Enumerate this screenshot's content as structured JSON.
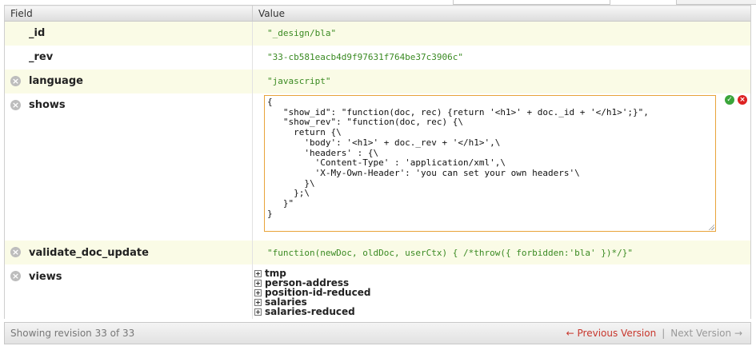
{
  "headers": {
    "field": "Field",
    "value": "Value"
  },
  "rows": {
    "id": {
      "key": "_id",
      "value": "\"_design/bla\""
    },
    "rev": {
      "key": "_rev",
      "value": "\"33-cb581eacb4d9f97631f764be37c3906c\""
    },
    "language": {
      "key": "language",
      "value": "\"javascript\""
    },
    "shows": {
      "key": "shows",
      "editor_text": "{\n   \"show_id\": \"function(doc, rec) {return '<h1>' + doc._id + '</h1>';}\",\n   \"show_rev\": \"function(doc, rec) {\\\n     return {\\\n       'body': '<h1>' + doc._rev + '</h1>',\\\n       'headers' : {\\\n         'Content-Type' : 'application/xml',\\\n         'X-My-Own-Header': 'you can set your own headers'\\\n       }\\\n     };\\\n   }\"\n}"
    },
    "validate": {
      "key": "validate_doc_update",
      "value": "\"function(newDoc, oldDoc, userCtx) { /*throw({ forbidden:'bla' })*/}\""
    },
    "views": {
      "key": "views",
      "items": [
        "tmp",
        "person-address",
        "position-id-reduced",
        "salaries",
        "salaries-reduced"
      ]
    }
  },
  "icons": {
    "delete": "×",
    "save": "✓",
    "cancel": "×",
    "expand": "+"
  },
  "footer": {
    "status": "Showing revision 33 of 33",
    "prev": "← Previous Version",
    "sep": "|",
    "next": "Next Version →"
  },
  "colors": {
    "value_text": "#3a8a22",
    "odd_row": "#fafbe6",
    "editor_border": "#e8a33a",
    "prev_link": "#c8372d"
  }
}
